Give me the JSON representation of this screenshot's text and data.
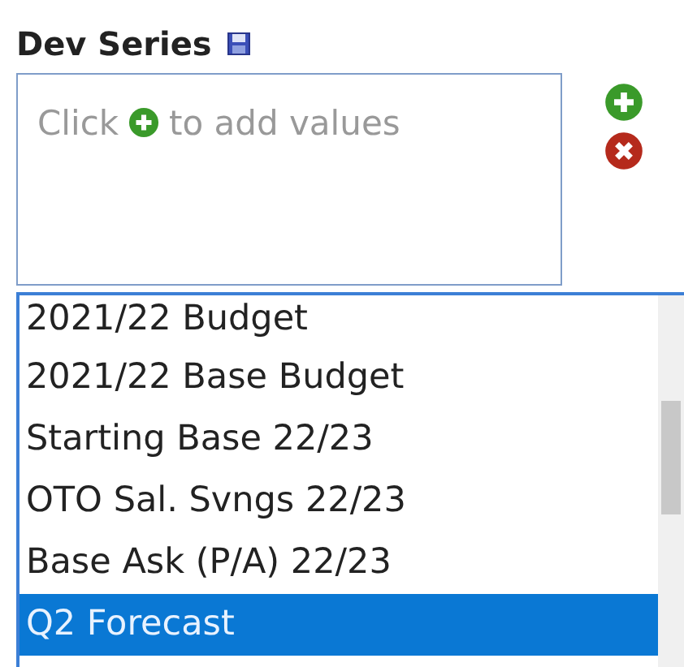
{
  "title": "Dev Series",
  "values_box": {
    "hint_before": "Click",
    "hint_after": "to add values"
  },
  "options": [
    {
      "label": "2021/22 Budget",
      "selected": false
    },
    {
      "label": "2021/22 Base Budget",
      "selected": false
    },
    {
      "label": "Starting Base 22/23",
      "selected": false
    },
    {
      "label": "OTO Sal. Svngs 22/23",
      "selected": false
    },
    {
      "label": "Base Ask (P/A) 22/23",
      "selected": false
    },
    {
      "label": "Q2 Forecast",
      "selected": true
    }
  ]
}
